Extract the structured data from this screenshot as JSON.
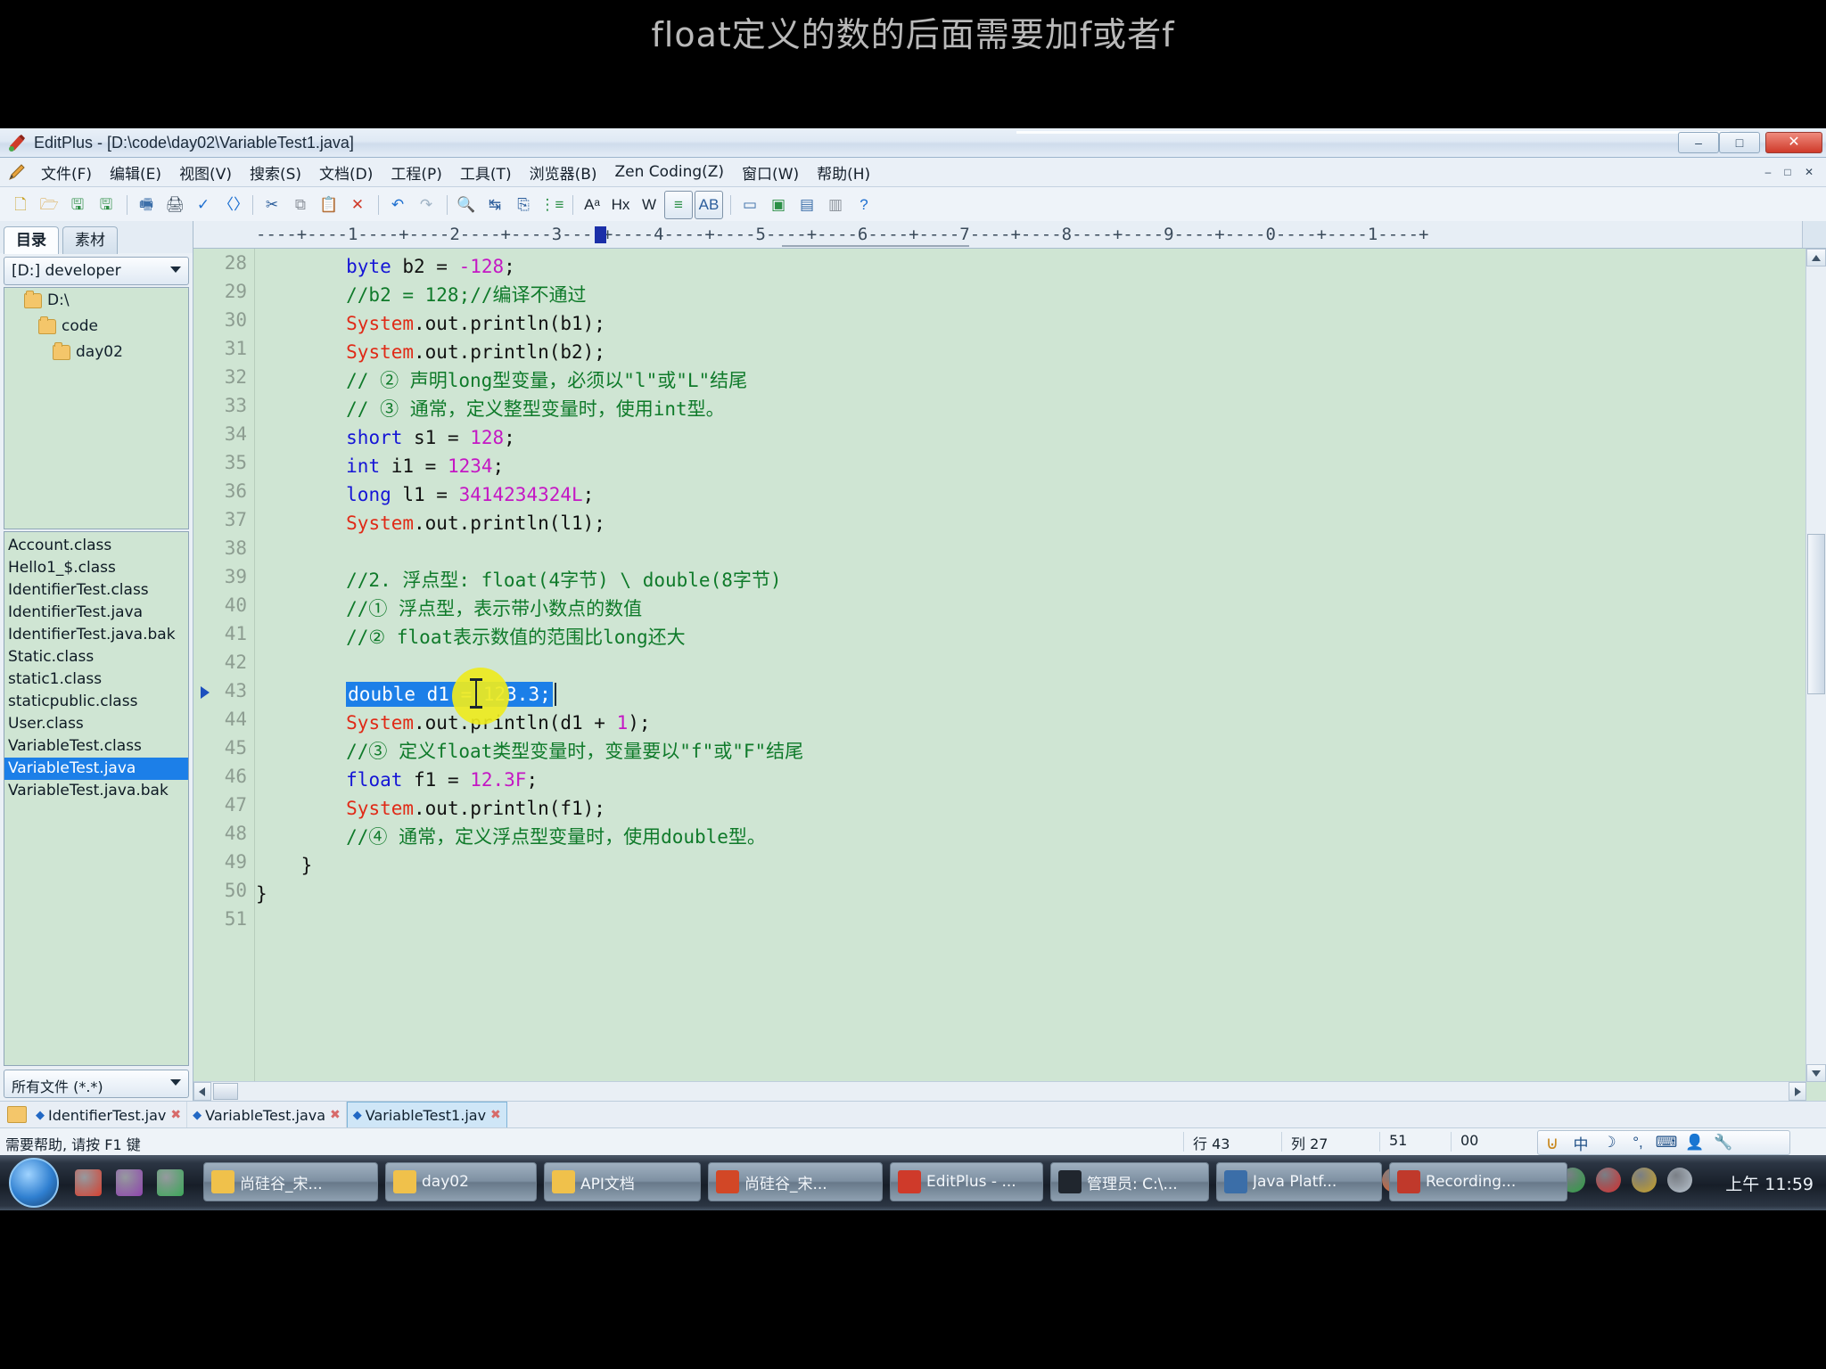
{
  "caption": {
    "text": "float定义的数的后面需要加f或者f"
  },
  "window": {
    "title": "EditPlus - [D:\\code\\day02\\VariableTest1.java]",
    "icon": "editplus-icon",
    "minimize": "–",
    "maximize": "□",
    "close": "✕"
  },
  "menu": {
    "pencil_icon": "pencil-icon",
    "items": [
      "文件(F)",
      "编辑(E)",
      "视图(V)",
      "搜索(S)",
      "文档(D)",
      "工程(P)",
      "工具(T)",
      "浏览器(B)",
      "Zen Coding(Z)",
      "窗口(W)",
      "帮助(H)"
    ],
    "mdi": {
      "minimize": "–",
      "maximize": "□",
      "close": "✕"
    }
  },
  "toolbar": {
    "buttons": [
      {
        "name": "new-file-icon",
        "glyph": "🗋",
        "color": "#c9a227"
      },
      {
        "name": "open-file-icon",
        "glyph": "🗁",
        "color": "#d8a13a"
      },
      {
        "name": "save-icon",
        "glyph": "🖫",
        "color": "#2f8f46"
      },
      {
        "name": "save-all-icon",
        "glyph": "🖫",
        "color": "#2f8f46"
      },
      {
        "name": "sep1",
        "glyph": "|",
        "color": ""
      },
      {
        "name": "print-preview-icon",
        "glyph": "🖷",
        "color": "#3b6ea8"
      },
      {
        "name": "print-icon",
        "glyph": "🖨",
        "color": "#3a4a5a"
      },
      {
        "name": "spellcheck-icon",
        "glyph": "✓",
        "color": "#1d6fd0"
      },
      {
        "name": "code-tag-icon",
        "glyph": "〈〉",
        "color": "#1d6fd0"
      },
      {
        "name": "sep2",
        "glyph": "|",
        "color": ""
      },
      {
        "name": "cut-icon",
        "glyph": "✂",
        "color": "#2b5d9b"
      },
      {
        "name": "copy-icon",
        "glyph": "⧉",
        "color": "#8a9099"
      },
      {
        "name": "paste-icon",
        "glyph": "📋",
        "color": "#c58a2d"
      },
      {
        "name": "delete-icon",
        "glyph": "✕",
        "color": "#d03a2a"
      },
      {
        "name": "sep3",
        "glyph": "|",
        "color": ""
      },
      {
        "name": "undo-icon",
        "glyph": "↶",
        "color": "#1d6fd0"
      },
      {
        "name": "redo-icon",
        "glyph": "↷",
        "color": "#9fb2c4"
      },
      {
        "name": "sep4",
        "glyph": "|",
        "color": ""
      },
      {
        "name": "find-icon",
        "glyph": "🔍",
        "color": "#2b5d9b"
      },
      {
        "name": "replace-icon",
        "glyph": "↹",
        "color": "#2b5d9b"
      },
      {
        "name": "goto-icon",
        "glyph": "⎘",
        "color": "#2b5d9b"
      },
      {
        "name": "bookmark-icon",
        "glyph": "⋮≡",
        "color": "#2b8f46"
      },
      {
        "name": "sep5",
        "glyph": "|",
        "color": ""
      },
      {
        "name": "font-size-icon",
        "glyph": "Aᵃ",
        "color": "#1a2530"
      },
      {
        "name": "hex-view-icon",
        "glyph": "Hx",
        "color": "#1a2530"
      },
      {
        "name": "word-wrap-icon",
        "glyph": "W",
        "color": "#1a2530"
      },
      {
        "name": "outline-icon",
        "glyph": "≡",
        "color": "#2b8f46"
      },
      {
        "name": "ascii-table-icon",
        "glyph": "AB",
        "color": "#2b5d9b"
      },
      {
        "name": "sep6",
        "glyph": "|",
        "color": ""
      },
      {
        "name": "browser-preview-icon",
        "glyph": "▭",
        "color": "#3b6ea8"
      },
      {
        "name": "ie-preview-icon",
        "glyph": "▣",
        "color": "#2b8f46"
      },
      {
        "name": "ftp-upload-icon",
        "glyph": "▤",
        "color": "#3b6ea8"
      },
      {
        "name": "user-tool-icon",
        "glyph": "▥",
        "color": "#8a9099"
      },
      {
        "name": "help-icon",
        "glyph": "?",
        "color": "#1d6fd0"
      }
    ]
  },
  "sidebar": {
    "tabs": [
      {
        "label": "目录",
        "active": true
      },
      {
        "label": "素材",
        "active": false
      }
    ],
    "drive_combo": "[D:] developer",
    "tree": [
      {
        "label": "D:\\",
        "depth": 0
      },
      {
        "label": "code",
        "depth": 1
      },
      {
        "label": "day02",
        "depth": 2
      }
    ],
    "files": [
      {
        "name": "Account.class",
        "selected": false
      },
      {
        "name": "Hello1_$.class",
        "selected": false
      },
      {
        "name": "IdentifierTest.class",
        "selected": false
      },
      {
        "name": "IdentifierTest.java",
        "selected": false
      },
      {
        "name": "IdentifierTest.java.bak",
        "selected": false
      },
      {
        "name": "Static.class",
        "selected": false
      },
      {
        "name": "static1.class",
        "selected": false
      },
      {
        "name": "staticpublic.class",
        "selected": false
      },
      {
        "name": "User.class",
        "selected": false
      },
      {
        "name": "VariableTest.class",
        "selected": false
      },
      {
        "name": "VariableTest.java",
        "selected": true
      },
      {
        "name": "VariableTest.java.bak",
        "selected": false
      }
    ],
    "filter": "所有文件 (*.*)"
  },
  "editor": {
    "ruler": "----+----1----+----2----+----3----+----4----+----5----+----6----+----7----+----8----+----9----+----0----+----1----+",
    "first_line": 28,
    "marker_line": 43,
    "lines": [
      {
        "n": 28,
        "tokens": [
          {
            "t": "        ",
            "c": "pl"
          },
          {
            "t": "byte",
            "c": "kw"
          },
          {
            "t": " b2 = ",
            "c": "pl"
          },
          {
            "t": "-128",
            "c": "num"
          },
          {
            "t": ";",
            "c": "pl"
          }
        ]
      },
      {
        "n": 29,
        "tokens": [
          {
            "t": "        //b2 = 128;//编译不通过",
            "c": "cm"
          }
        ]
      },
      {
        "n": 30,
        "tokens": [
          {
            "t": "        ",
            "c": "pl"
          },
          {
            "t": "System",
            "c": "sys"
          },
          {
            "t": ".out.println(b1);",
            "c": "pl"
          }
        ]
      },
      {
        "n": 31,
        "tokens": [
          {
            "t": "        ",
            "c": "pl"
          },
          {
            "t": "System",
            "c": "sys"
          },
          {
            "t": ".out.println(b2);",
            "c": "pl"
          }
        ]
      },
      {
        "n": 32,
        "tokens": [
          {
            "t": "        // ② 声明long型变量，必须以\"l\"或\"L\"结尾",
            "c": "cm"
          }
        ]
      },
      {
        "n": 33,
        "tokens": [
          {
            "t": "        // ③ 通常，定义整型变量时，使用int型。",
            "c": "cm"
          }
        ]
      },
      {
        "n": 34,
        "tokens": [
          {
            "t": "        ",
            "c": "pl"
          },
          {
            "t": "short",
            "c": "kw"
          },
          {
            "t": " s1 = ",
            "c": "pl"
          },
          {
            "t": "128",
            "c": "num"
          },
          {
            "t": ";",
            "c": "pl"
          }
        ]
      },
      {
        "n": 35,
        "tokens": [
          {
            "t": "        ",
            "c": "pl"
          },
          {
            "t": "int",
            "c": "kw"
          },
          {
            "t": " i1 = ",
            "c": "pl"
          },
          {
            "t": "1234",
            "c": "num"
          },
          {
            "t": ";",
            "c": "pl"
          }
        ]
      },
      {
        "n": 36,
        "tokens": [
          {
            "t": "        ",
            "c": "pl"
          },
          {
            "t": "long",
            "c": "kw"
          },
          {
            "t": " l1 = ",
            "c": "pl"
          },
          {
            "t": "3414234324L",
            "c": "num"
          },
          {
            "t": ";",
            "c": "pl"
          }
        ]
      },
      {
        "n": 37,
        "tokens": [
          {
            "t": "        ",
            "c": "pl"
          },
          {
            "t": "System",
            "c": "sys"
          },
          {
            "t": ".out.println(l1);",
            "c": "pl"
          }
        ]
      },
      {
        "n": 38,
        "tokens": []
      },
      {
        "n": 39,
        "tokens": [
          {
            "t": "        //2. 浮点型: float(4字节) \\ double(8字节)",
            "c": "cm"
          }
        ]
      },
      {
        "n": 40,
        "tokens": [
          {
            "t": "        //① 浮点型，表示带小数点的数值",
            "c": "cm"
          }
        ]
      },
      {
        "n": 41,
        "tokens": [
          {
            "t": "        //② float表示数值的范围比long还大",
            "c": "cm"
          }
        ]
      },
      {
        "n": 42,
        "tokens": []
      },
      {
        "n": 43,
        "selected": true,
        "sel_text": "double d1 = 123.3;",
        "tokens": [
          {
            "t": "        ",
            "c": "pl"
          }
        ]
      },
      {
        "n": 44,
        "tokens": [
          {
            "t": "        ",
            "c": "pl"
          },
          {
            "t": "System",
            "c": "sys"
          },
          {
            "t": ".out.println(d1 + ",
            "c": "pl"
          },
          {
            "t": "1",
            "c": "num"
          },
          {
            "t": ");",
            "c": "pl"
          }
        ]
      },
      {
        "n": 45,
        "tokens": [
          {
            "t": "        //③ 定义float类型变量时，变量要以\"f\"或\"F\"结尾",
            "c": "cm"
          }
        ]
      },
      {
        "n": 46,
        "tokens": [
          {
            "t": "        ",
            "c": "pl"
          },
          {
            "t": "float",
            "c": "kw"
          },
          {
            "t": " f1 = ",
            "c": "pl"
          },
          {
            "t": "12.3F",
            "c": "num"
          },
          {
            "t": ";",
            "c": "pl"
          }
        ]
      },
      {
        "n": 47,
        "tokens": [
          {
            "t": "        ",
            "c": "pl"
          },
          {
            "t": "System",
            "c": "sys"
          },
          {
            "t": ".out.println(f1);",
            "c": "pl"
          }
        ]
      },
      {
        "n": 48,
        "tokens": [
          {
            "t": "        //④ 通常，定义浮点型变量时，使用double型。",
            "c": "cm"
          }
        ]
      },
      {
        "n": 49,
        "tokens": [
          {
            "t": "    }",
            "c": "pl"
          }
        ]
      },
      {
        "n": 50,
        "tokens": [
          {
            "t": "}",
            "c": "pl"
          }
        ]
      },
      {
        "n": 51,
        "tokens": []
      }
    ],
    "selection_color": "#1c7fe8",
    "background_color": "#cfe5d3"
  },
  "doctabs": {
    "folder_icon": "folder-icon",
    "tabs": [
      {
        "label": "IdentifierTest.jav",
        "active": false
      },
      {
        "label": "VariableTest.java",
        "active": false
      },
      {
        "label": "VariableTest1.jav",
        "active": true
      }
    ]
  },
  "statusbar": {
    "hint": "需要帮助, 请按 F1 键",
    "line": "行 43",
    "column": "列 27",
    "value_a": "51",
    "value_b": "00",
    "ime": [
      "中",
      "☽",
      "°,",
      "⌨",
      "👤",
      "🔧"
    ]
  },
  "taskbar": {
    "start_icon": "windows-start-orb",
    "quicklaunch": [
      {
        "name": "quicklaunch-icon-1",
        "color": "#d6402f"
      },
      {
        "name": "quicklaunch-icon-2",
        "color": "#8e44ad"
      },
      {
        "name": "chrome-icon",
        "color": "#3aa757"
      }
    ],
    "tasks": [
      {
        "label": "尚硅谷_宋...",
        "icon_color": "#f0c14b"
      },
      {
        "label": "day02",
        "icon_color": "#f0c14b"
      },
      {
        "label": "API文档",
        "icon_color": "#f0c14b"
      },
      {
        "label": "尚硅谷_宋...",
        "icon_color": "#d24726"
      },
      {
        "label": "EditPlus - ...",
        "icon_color": "#cf3a2a"
      },
      {
        "label": "管理员: C:\\...",
        "icon_color": "#20262e"
      },
      {
        "label": "Java Platf...",
        "icon_color": "#3b6ea8"
      },
      {
        "label": "Recording...",
        "icon_color": "#c0392b"
      }
    ],
    "tray": [
      {
        "name": "sogou-icon",
        "color": "#e8622a"
      },
      {
        "name": "show-hidden-icons",
        "color": "#8fa2b4"
      },
      {
        "name": "drive-icon",
        "color": "#e8b63a"
      },
      {
        "name": "volume-icon",
        "color": "#dfe8f2"
      },
      {
        "name": "network-icon",
        "color": "#2a62b5"
      },
      {
        "name": "security-icon",
        "color": "#2f9e44"
      },
      {
        "name": "record-icon",
        "color": "#d32f2f"
      },
      {
        "name": "tools-icon",
        "color": "#c9a227"
      },
      {
        "name": "usb-icon",
        "color": "#b9c4cf"
      }
    ],
    "clock": "上午 11:59"
  }
}
